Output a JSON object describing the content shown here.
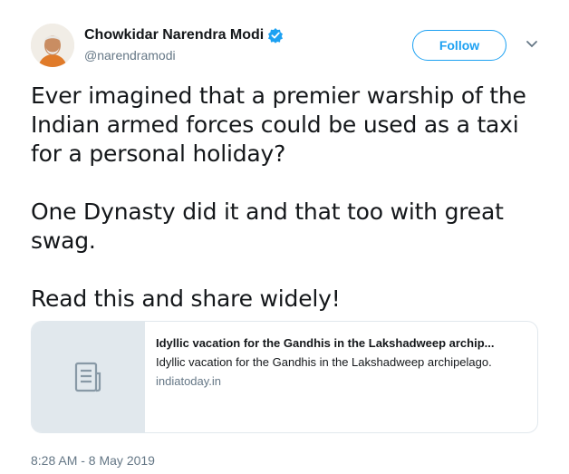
{
  "header": {
    "display_name": "Chowkidar Narendra Modi",
    "handle": "@narendramodi",
    "follow_label": "Follow"
  },
  "tweet": {
    "lines": [
      "Ever imagined that a premier warship of the",
      "Indian armed forces could be used as a taxi",
      "for a personal holiday?",
      "One Dynasty did it and that too with great",
      "swag.",
      "Read this and share widely!"
    ]
  },
  "card": {
    "title": "Idyllic vacation for the Gandhis in the Lakshadweep archip...",
    "description": "Idyllic vacation for the Gandhis in the Lakshadweep archipelago.",
    "domain": "indiatoday.in"
  },
  "timestamp": "8:28 AM - 8 May 2019",
  "colors": {
    "accent": "#1da1f2",
    "secondary_text": "#657786",
    "border": "#e1e8ed"
  },
  "icons": {
    "verified": "verified-badge-icon",
    "caret": "chevron-down-icon",
    "card_placeholder": "document-icon"
  }
}
